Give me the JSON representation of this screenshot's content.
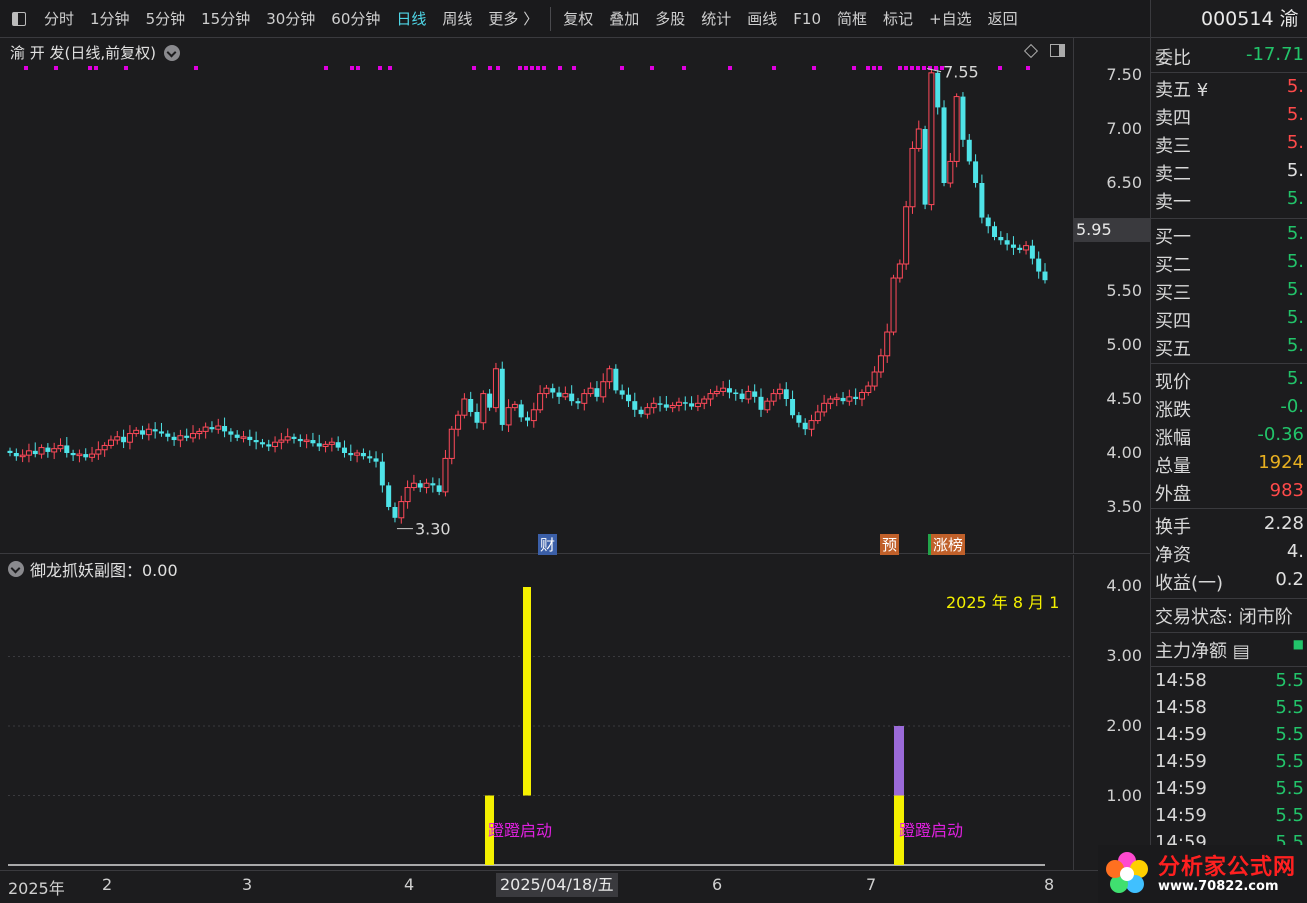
{
  "toolbar": {
    "items": [
      "分时",
      "1分钟",
      "5分钟",
      "15分钟",
      "30分钟",
      "60分钟",
      "日线",
      "周线",
      "更多 〉"
    ],
    "active": "日线",
    "tools": [
      "复权",
      "叠加",
      "多股",
      "统计",
      "画线",
      "F10",
      "简框",
      "标记",
      "+自选",
      "返回"
    ]
  },
  "main_chart": {
    "title": "渝 开 发(日线,前复权)",
    "y_ticks": [
      "7.50",
      "7.00",
      "6.50",
      "6.00",
      "5.50",
      "5.00",
      "4.50",
      "4.00",
      "3.50"
    ],
    "current_price_marker": "5.95",
    "high_label": "7.55",
    "low_label": "3.30",
    "signal_labels": [
      {
        "text": "财",
        "color": "#3b5fa8"
      },
      {
        "text": "预",
        "color": "#c0602a"
      },
      {
        "text": "涨榜",
        "color": "#c0602a"
      }
    ],
    "colors": {
      "up": "#ff4a5a",
      "down": "#4fe3e8",
      "dots": "#e000e0"
    }
  },
  "sub_chart": {
    "title": "御龙抓妖副图：0.00",
    "y_ticks": [
      "4.00",
      "3.00",
      "2.00",
      "1.00"
    ],
    "date_stamp": "2025 年 8 月 1",
    "bar_label": "蹬蹬启动",
    "colors": {
      "bar": "#f4f000",
      "bar_alt": "#9a6ad8",
      "label": "#e020e0"
    }
  },
  "date_axis": {
    "labels": [
      "2025年",
      "2",
      "3",
      "4",
      "6",
      "7",
      "8"
    ],
    "cursor_date": "2025/04/18/五"
  },
  "quote": {
    "code": "000514 渝",
    "rows": [
      {
        "label": "委比",
        "value": "-17.71",
        "color": "green"
      },
      {
        "label": "卖五 ¥",
        "value": "5.",
        "color": "red"
      },
      {
        "label": "卖四",
        "value": "5.",
        "color": "red"
      },
      {
        "label": "卖三",
        "value": "5.",
        "color": "red"
      },
      {
        "label": "卖二",
        "value": "5.",
        "color": "white"
      },
      {
        "label": "卖一",
        "value": "5.",
        "color": "green"
      },
      {
        "label": "买一",
        "value": "5.",
        "color": "green"
      },
      {
        "label": "买二",
        "value": "5.",
        "color": "green"
      },
      {
        "label": "买三",
        "value": "5.",
        "color": "green"
      },
      {
        "label": "买四",
        "value": "5.",
        "color": "green"
      },
      {
        "label": "买五",
        "value": "5.",
        "color": "green"
      },
      {
        "label": "现价",
        "value": "5.",
        "color": "green"
      },
      {
        "label": "涨跌",
        "value": "-0.",
        "color": "green"
      },
      {
        "label": "涨幅",
        "value": "-0.36",
        "color": "green"
      },
      {
        "label": "总量",
        "value": "1924",
        "color": "gold"
      },
      {
        "label": "外盘",
        "value": "983",
        "color": "red"
      },
      {
        "label": "换手",
        "value": "2.28",
        "color": "white"
      },
      {
        "label": "净资",
        "value": "4.",
        "color": "white"
      },
      {
        "label": "收益(一)",
        "value": "0.2",
        "color": "white"
      }
    ],
    "trade_status": "交易状态: 闭市阶",
    "net_flow_label": "主力净额",
    "ticks": [
      {
        "time": "14:58",
        "value": "5.5"
      },
      {
        "time": "14:58",
        "value": "5.5"
      },
      {
        "time": "14:59",
        "value": "5.5"
      },
      {
        "time": "14:59",
        "value": "5.5"
      },
      {
        "time": "14:59",
        "value": "5.5"
      },
      {
        "time": "14:59",
        "value": "5.5"
      },
      {
        "time": "14:59",
        "value": "5.5"
      }
    ]
  },
  "logo": {
    "main": "分析家公式网",
    "url": "www.70822.com"
  }
}
